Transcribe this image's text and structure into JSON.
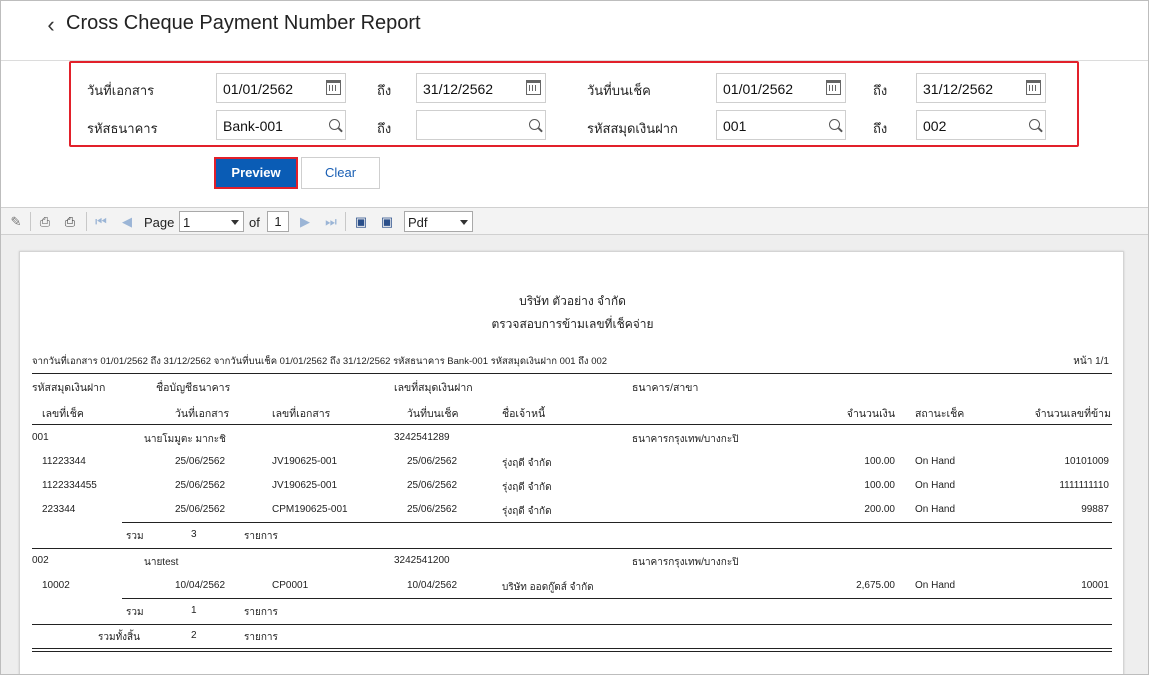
{
  "header": {
    "back_icon": "chevron-left-icon",
    "title": "Cross Cheque Payment Number Report"
  },
  "filters": {
    "doc_date_label": "วันที่เอกสาร",
    "doc_date_from": "01/01/2562",
    "to_label": "ถึง",
    "doc_date_to": "31/12/2562",
    "cheque_date_label": "วันที่บนเช็ค",
    "cheque_date_from": "01/01/2562",
    "cheque_date_to": "31/12/2562",
    "bank_code_label": "รหัสธนาคาร",
    "bank_code_from": "Bank-001",
    "bank_code_to": "",
    "passbook_label": "รหัสสมุดเงินฝาก",
    "passbook_from": "001",
    "passbook_to": "002"
  },
  "actions": {
    "preview": "Preview",
    "clear": "Clear"
  },
  "toolbar": {
    "page_label": "Page",
    "page_value": "1",
    "of_label": "of",
    "page_total": "1",
    "export_format": "Pdf"
  },
  "report": {
    "company": "บริษัท ตัวอย่าง จำกัด",
    "title": "ตรวจสอบการข้ามเลขที่เช็คจ่าย",
    "criteria": "จากวันที่เอกสาร 01/01/2562 ถึง 31/12/2562 จากวันที่บนเช็ค 01/01/2562 ถึง 31/12/2562 รหัสธนาคาร Bank-001 รหัสสมุดเงินฝาก 001 ถึง 002",
    "page_info": "หน้า 1/1",
    "columns1": {
      "passbook_code": "รหัสสมุดเงินฝาก",
      "account_name": "ชื่อบัญชีธนาคาร",
      "passbook_no": "เลขที่สมุดเงินฝาก",
      "bank_branch": "ธนาคาร/สาขา"
    },
    "columns2": {
      "cheque_no": "เลขที่เช็ค",
      "doc_date": "วันที่เอกสาร",
      "doc_no": "เลขที่เอกสาร",
      "cheque_date": "วันที่บนเช็ค",
      "creditor": "ชื่อเจ้าหนี้",
      "amount": "จำนวนเงิน",
      "status": "สถานะเช็ค",
      "skip_no": "จำนวนเลขที่ข้าม"
    },
    "groups": [
      {
        "code": "001",
        "account_name": "นายโมมูตะ มากะชิ",
        "passbook_no": "3242541289",
        "bank": "ธนาคารกรุงเทพ/บางกะปิ",
        "rows": [
          {
            "cheque_no": "11223344",
            "doc_date": "25/06/2562",
            "doc_no": "JV190625-001",
            "cheque_date": "25/06/2562",
            "creditor": "รุ่งฤดี จำกัด",
            "amount": "100.00",
            "status": "On Hand",
            "skip": "10101009"
          },
          {
            "cheque_no": "1122334455",
            "doc_date": "25/06/2562",
            "doc_no": "JV190625-001",
            "cheque_date": "25/06/2562",
            "creditor": "รุ่งฤดี จำกัด",
            "amount": "100.00",
            "status": "On Hand",
            "skip": "1111111110"
          },
          {
            "cheque_no": "223344",
            "doc_date": "25/06/2562",
            "doc_no": "CPM190625-001",
            "cheque_date": "25/06/2562",
            "creditor": "รุ่งฤดี จำกัด",
            "amount": "200.00",
            "status": "On Hand",
            "skip": "99887"
          }
        ],
        "total_label": "รวม",
        "total_count": "3",
        "unit": "รายการ"
      },
      {
        "code": "002",
        "account_name": "นายtest",
        "passbook_no": "3242541200",
        "bank": "ธนาคารกรุงเทพ/บางกะปิ",
        "rows": [
          {
            "cheque_no": "10002",
            "doc_date": "10/04/2562",
            "doc_no": "CP0001",
            "cheque_date": "10/04/2562",
            "creditor": "บริษัท ออดกู๊ดส์ จำกัด",
            "amount": "2,675.00",
            "status": "On Hand",
            "skip": "10001"
          }
        ],
        "total_label": "รวม",
        "total_count": "1",
        "unit": "รายการ"
      }
    ],
    "grand_total_label": "รวมทั้งสิ้น",
    "grand_total_count": "2",
    "grand_total_unit": "รายการ"
  }
}
